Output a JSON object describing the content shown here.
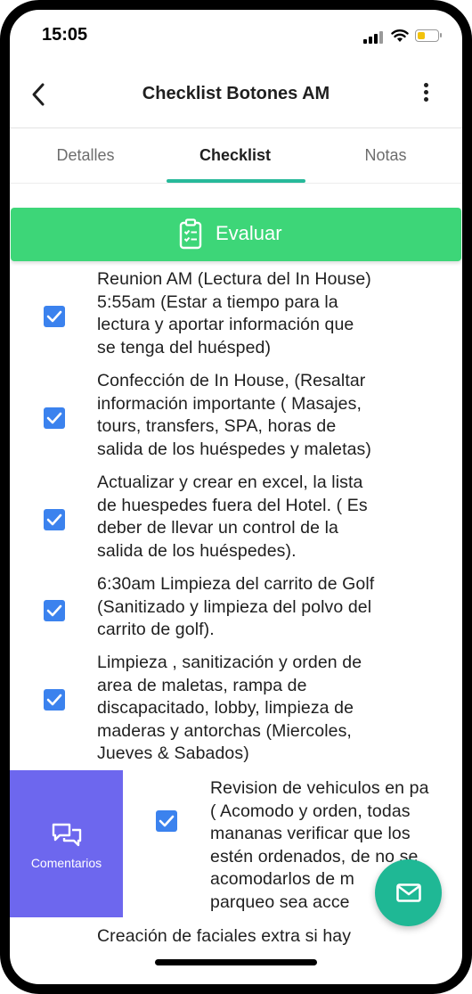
{
  "status_bar": {
    "time": "15:05"
  },
  "header": {
    "title": "Checklist Botones AM"
  },
  "tabs": [
    {
      "label": "Detalles"
    },
    {
      "label": "Checklist"
    },
    {
      "label": "Notas"
    }
  ],
  "active_tab": "Checklist",
  "evaluate_button": {
    "label": "Evaluar"
  },
  "checklist": [
    {
      "checked": true,
      "lines": [
        "Reunion AM (Lectura del In House)",
        "5:55am (Estar a tiempo para la",
        "lectura y aportar información que",
        "se tenga del huésped)"
      ]
    },
    {
      "checked": true,
      "lines": [
        "Confección de In House, (Resaltar",
        "información importante ( Masajes,",
        "tours, transfers, SPA, horas de",
        "salida de los huéspedes y maletas)"
      ]
    },
    {
      "checked": true,
      "lines": [
        "Actualizar y crear en excel, la lista",
        "de huespedes fuera del Hotel. ( Es",
        "deber de llevar un control de la",
        "salida de los huéspedes)."
      ]
    },
    {
      "checked": true,
      "lines": [
        "6:30am Limpieza del carrito de Golf",
        "(Sanitizado y limpieza del polvo del",
        "carrito de golf)."
      ]
    },
    {
      "checked": true,
      "lines": [
        "Limpieza , sanitización y orden de",
        "area de maletas, rampa de",
        "discapacitado, lobby, limpieza de",
        "maderas y antorchas (Miercoles,",
        "Jueves & Sabados)"
      ]
    },
    {
      "checked": true,
      "lines": [
        "Revision de vehiculos en pa",
        "( Acomodo y orden, todas",
        "mananas verificar que los",
        "estén ordenados, de no se",
        "acomodarlos de m",
        "parqueo sea acce"
      ]
    },
    {
      "checked": false,
      "lines": [
        "Creación de faciales extra si hay"
      ]
    }
  ],
  "swipe_action": {
    "label": "Comentarios",
    "icon": "chat-bubbles-icon",
    "color": "#6d67ee"
  },
  "fab": {
    "icon": "mail-icon",
    "color": "#1fb895"
  },
  "colors": {
    "accent": "#27b99a",
    "evaluate": "#3dd678",
    "checkbox": "#3b82ee"
  }
}
